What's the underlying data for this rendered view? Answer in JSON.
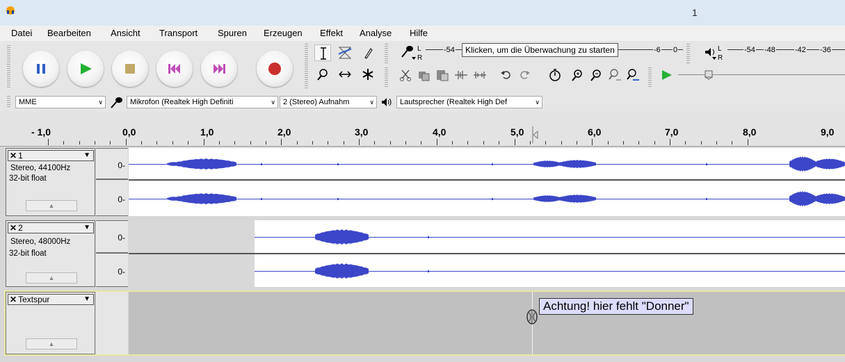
{
  "window": {
    "title": "1"
  },
  "menu": [
    "Datei",
    "Bearbeiten",
    "Ansicht",
    "Transport",
    "Spuren",
    "Erzeugen",
    "Effekt",
    "Analyse",
    "Hilfe"
  ],
  "transport": {
    "pause": "pause-icon",
    "play": "play-icon",
    "stop": "stop-icon",
    "skip_start": "skip-to-start-icon",
    "skip_end": "skip-to-end-icon",
    "record": "record-icon"
  },
  "meters": {
    "record_lr": "L\nR",
    "record_scale_left": "-54",
    "monitor_hint": "Klicken, um die Überwachung zu starten",
    "record_scale_right": [
      "-6",
      "0"
    ],
    "playback_lr": "L\nR",
    "playback_scale": [
      "-54",
      "-48",
      "-42",
      "-36"
    ]
  },
  "device": {
    "host": "MME",
    "input": "Mikrofon (Realtek High Definiti",
    "channels": "2 (Stereo) Aufnahm",
    "output": "Lautsprecher (Realtek High Def"
  },
  "ruler": {
    "labels": [
      "- 1,0",
      "0,0",
      "1,0",
      "2,0",
      "3,0",
      "4,0",
      "5,0",
      "6,0",
      "7,0",
      "8,0",
      "9,0"
    ]
  },
  "tracks": [
    {
      "name": "1",
      "rate": "Stereo, 44100Hz",
      "format": "32-bit float",
      "scale": [
        "0-",
        "0-"
      ]
    },
    {
      "name": "2",
      "rate": "Stereo, 48000Hz",
      "format": "32-bit float",
      "scale": [
        "0-",
        "0-"
      ]
    }
  ],
  "label_track": {
    "name": "Textspur",
    "label_text": "Achtung! hier fehlt \"Donner\""
  },
  "colors": {
    "waveform": "#3c46c8",
    "waveform_light": "#6570e0",
    "wave_background": "#ffffff",
    "unselected_bg": "#d8d8d8",
    "label_bg": "#dcdcff",
    "label_track_border": "#e8e8a0"
  }
}
